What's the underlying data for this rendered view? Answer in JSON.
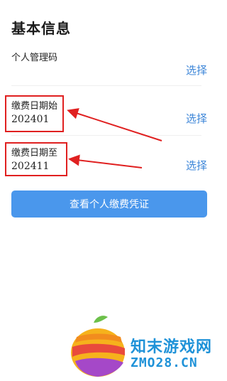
{
  "page": {
    "title": "基本信息"
  },
  "fields": [
    {
      "label": "个人管理码",
      "value": "",
      "action": "选择"
    },
    {
      "label": "缴费日期始",
      "value": "202401",
      "action": "选择"
    },
    {
      "label": "缴费日期至",
      "value": "202411",
      "action": "选择"
    }
  ],
  "submit": {
    "label": "查看个人缴费凭证"
  },
  "watermark": {
    "name": "知末游戏网",
    "url": "ZMO28.CN"
  },
  "colors": {
    "accent": "#3d86d8",
    "button": "#4a97ec",
    "annotation": "#e02020"
  }
}
